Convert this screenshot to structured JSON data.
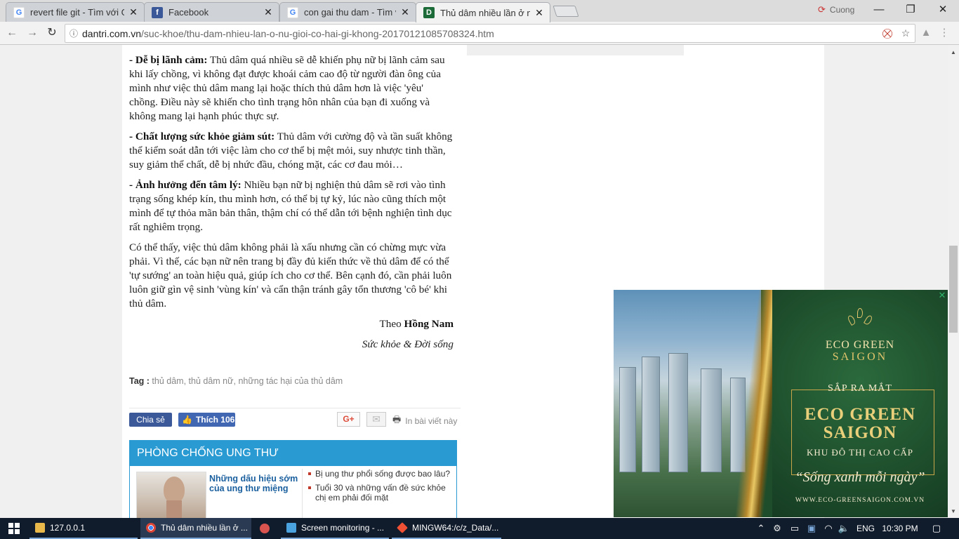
{
  "browser": {
    "tabs": [
      {
        "title": "revert file git - Tìm với Go",
        "favicon": "google-icon",
        "active": false
      },
      {
        "title": "Facebook",
        "favicon": "facebook-icon",
        "active": false
      },
      {
        "title": "con gai thu dam - Tìm với G",
        "favicon": "google-icon",
        "active": false
      },
      {
        "title": "Thủ dâm nhiều lần ở nữ g",
        "favicon": "dantri-icon",
        "active": true
      }
    ],
    "tab_close": "✕",
    "profile_name": "Cuong",
    "window": {
      "minimize": "—",
      "maximize": "❐",
      "close": "✕"
    },
    "url_host": "dantri.com.vn",
    "url_path": "/suc-khoe/thu-dam-nhieu-lan-o-nu-gioi-co-hai-gi-khong-20170121085708324.htm",
    "nav": {
      "back": "←",
      "forward": "→",
      "reload": "↻"
    }
  },
  "article": {
    "p1_bold": "- Dễ bị lãnh cảm:",
    "p1_text": " Thủ dâm quá nhiều sẽ dễ khiến phụ nữ bị lãnh cảm sau khi lấy chồng, vì không đạt được khoái cảm cao độ từ người đàn ông của mình như việc thủ dâm mang lại hoặc thích thủ dâm hơn là việc 'yêu' chồng. Điều này sẽ khiến cho tình trạng hôn nhân của bạn đi xuống và không mang lại hạnh phúc thực sự.",
    "p2_bold": "- Chất lượng sức khỏe giảm sút:",
    "p2_text": " Thủ dâm với cường độ và tần suất không thể kiểm soát dẫn tới việc làm cho cơ thể bị mệt mỏi, suy nhược tinh thần, suy giảm thể chất, dễ bị nhức đầu, chóng mặt, các cơ đau mỏi…",
    "p3_bold": "- Ảnh hưởng đến tâm lý:",
    "p3_text": " Nhiều bạn nữ bị nghiện thủ dâm sẽ rơi vào tình trạng sống khép kín, thu mình hơn, có thể bị tự kỷ, lúc nào cũng thích một mình để tự thỏa mãn bản thân, thậm chí có thể dẫn tới bệnh nghiện tình dục rất nghiêm trọng.",
    "p4_text": "Có thể thấy, việc thủ dâm không phải là xấu nhưng cần có chừng mực vừa phải. Vì thế, các bạn nữ nên trang bị đầy đủ kiến thức về thủ dâm để có thể 'tự sướng' an toàn hiệu quả, giúp ích cho cơ thể. Bên cạnh đó, cần phải luôn luôn giữ gìn vệ sinh 'vùng kín' và cẩn thận tránh gây tổn thương 'cô bé' khi thủ dâm.",
    "byline_prefix": "Theo ",
    "byline_author": "Hồng Nam",
    "source": "Sức khỏe & Đời sống"
  },
  "tags": {
    "label": "Tag :",
    "items": [
      "thủ dâm",
      "thủ dâm nữ",
      "những tác hại của thủ dâm"
    ]
  },
  "share": {
    "share_label": "Chia sẻ",
    "like_label": "Thích 106",
    "gplus_label": "G+",
    "print_label": "In bài viết này"
  },
  "cancer_box": {
    "heading": "PHÒNG CHỐNG UNG THƯ",
    "featured_title": "Những dấu hiệu sớm của ung thư miệng",
    "links": [
      "Bị ung thư phổi sống được bao lâu?",
      "Tuổi 30 và những vấn đề sức khỏe chị em phải đối mặt"
    ]
  },
  "ad": {
    "brand_line1": "ECO GREEN",
    "brand_line2": "SAIGON",
    "coming_soon": "SẮP RA MẮT",
    "big_line1": "ECO GREEN",
    "big_line2": "SAIGON",
    "tagline": "KHU ĐÔ THỊ CAO CẤP",
    "slogan": "“Sống xanh mỗi ngày”",
    "website": "WWW.ECO-GREENSAIGON.COM.VN",
    "close": "✕",
    "colors": {
      "green": "#1e4d2b",
      "gold": "#e9cf7a"
    }
  },
  "taskbar": {
    "items": [
      {
        "label": "127.0.0.1",
        "icon": "folder-icon"
      },
      {
        "label": "Thủ dâm nhiều lần ở ...",
        "icon": "chrome-icon"
      },
      {
        "label": "",
        "icon": "paint-icon"
      },
      {
        "label": "Screen monitoring - ...",
        "icon": "app-icon"
      },
      {
        "label": "MINGW64:/c/z_Data/...",
        "icon": "git-icon"
      }
    ],
    "lang": "ENG",
    "time": "10:30 PM"
  }
}
